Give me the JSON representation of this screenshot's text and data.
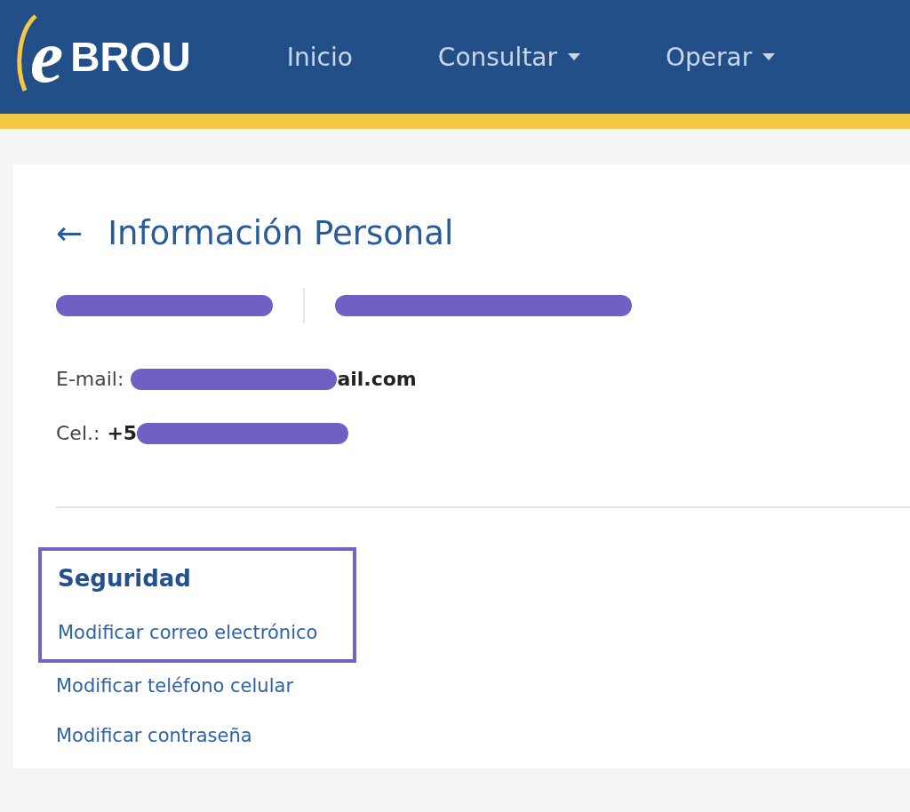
{
  "header": {
    "logo": {
      "letter": "e",
      "name": "BROU"
    },
    "nav": [
      {
        "label": "Inicio",
        "dropdown": false
      },
      {
        "label": "Consultar",
        "dropdown": true
      },
      {
        "label": "Operar",
        "dropdown": true
      }
    ]
  },
  "page": {
    "back": "←",
    "title": "Información Personal",
    "names": [
      {
        "kind": "redacted"
      },
      {
        "kind": "redacted"
      }
    ],
    "contacts": [
      {
        "label": "E-mail:",
        "parts": [
          {
            "kind": "redacted"
          },
          {
            "kind": "text",
            "text": "ail.com"
          }
        ]
      },
      {
        "label": "Cel.:",
        "parts": [
          {
            "kind": "text",
            "text": "+5"
          },
          {
            "kind": "redacted"
          }
        ]
      }
    ],
    "security": {
      "title": "Seguridad",
      "highlighted": true,
      "links": [
        {
          "label": "Modificar correo electrónico",
          "highlighted": true
        },
        {
          "label": "Modificar teléfono celular",
          "highlighted": false
        },
        {
          "label": "Modificar contraseña",
          "highlighted": false
        }
      ]
    }
  }
}
